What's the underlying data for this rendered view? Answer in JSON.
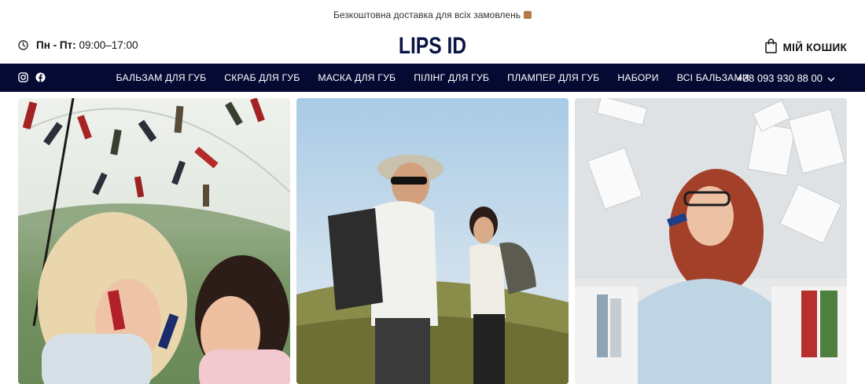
{
  "announcement": {
    "text": "Безкоштовна доставка для всіх замовлень",
    "icon": "box-icon"
  },
  "header": {
    "hours_days": "Пн - Пт:",
    "hours_time": "09:00–17:00",
    "logo": "LIPS ID",
    "cart_label": "МІЙ КОШИК"
  },
  "nav": {
    "social": [
      "instagram-icon",
      "facebook-icon"
    ],
    "items": [
      "БАЛЬЗАМ ДЛЯ ГУБ",
      "СКРАБ ДЛЯ ГУБ",
      "МАСКА ДЛЯ ГУБ",
      "ПІЛІНГ ДЛЯ ГУБ",
      "ПЛАМПЕР ДЛЯ ГУБ",
      "НАБОРИ",
      "ВСІ БАЛЬЗАМИ"
    ],
    "phone": "+38 093 930 88 00"
  },
  "colors": {
    "navbar_bg": "#050a33",
    "logo": "#0a1442"
  }
}
